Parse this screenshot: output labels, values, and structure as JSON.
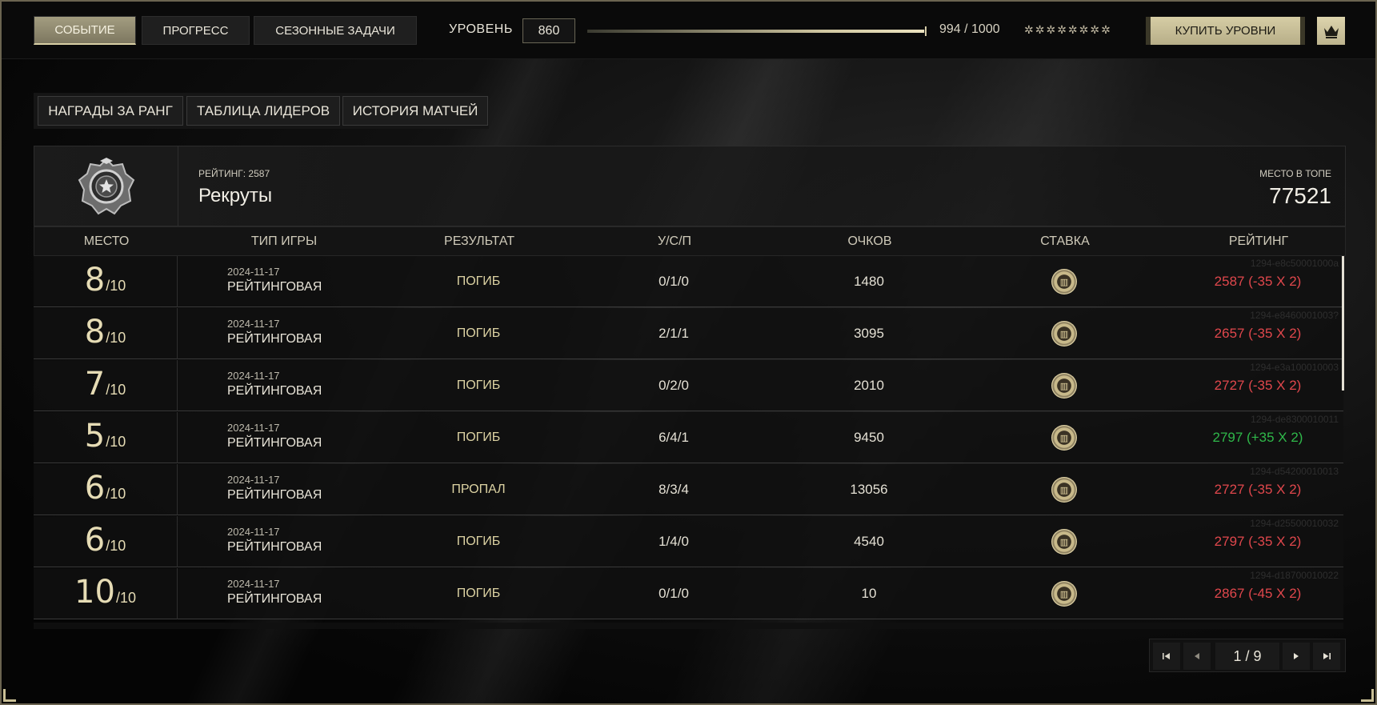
{
  "top_tabs": [
    {
      "label": "СОБЫТИЕ",
      "active": true
    },
    {
      "label": "ПРОГРЕСС",
      "active": false
    },
    {
      "label": "СЕЗОННЫЕ ЗАДАЧИ",
      "active": false
    }
  ],
  "level": {
    "label": "УРОВЕНЬ",
    "value": "860",
    "xp_text": "994 / 1000",
    "xp_fraction": 0.994,
    "stars": "✲✲✲✲✲✲✲✲"
  },
  "buy_levels_label": "КУПИТЬ УРОВНИ",
  "crown_icon": "crown-icon",
  "sub_tabs": [
    "НАГРАДЫ ЗА РАНГ",
    "ТАБЛИЦА ЛИДЕРОВ",
    "ИСТОРИЯ МАТЧЕЙ"
  ],
  "rank": {
    "rating_label": "РЕЙТИНГ: 2587",
    "name": "Рекруты",
    "top_label": "МЕСТО В ТОПЕ",
    "top_value": "77521"
  },
  "table": {
    "headers": [
      "МЕСТО",
      "ТИП ИГРЫ",
      "РЕЗУЛЬТАТ",
      "У/С/П",
      "ОЧКОВ",
      "СТАВКА",
      "РЕЙТИНГ"
    ],
    "rows": [
      {
        "place": "8",
        "of": "/10",
        "date": "2024-11-17",
        "type": "РЕЙТИНГОВАЯ",
        "result": "ПОГИБ",
        "ksa": "0/1/0",
        "points": "1480",
        "rating": "2587 (-35 X 2)",
        "positive": false,
        "id": "1294-e8c50001000a"
      },
      {
        "place": "8",
        "of": "/10",
        "date": "2024-11-17",
        "type": "РЕЙТИНГОВАЯ",
        "result": "ПОГИБ",
        "ksa": "2/1/1",
        "points": "3095",
        "rating": "2657 (-35 X 2)",
        "positive": false,
        "id": "1294-e8460001003?"
      },
      {
        "place": "7",
        "of": "/10",
        "date": "2024-11-17",
        "type": "РЕЙТИНГОВАЯ",
        "result": "ПОГИБ",
        "ksa": "0/2/0",
        "points": "2010",
        "rating": "2727 (-35 X 2)",
        "positive": false,
        "id": "1294-e3a100010003"
      },
      {
        "place": "5",
        "of": "/10",
        "date": "2024-11-17",
        "type": "РЕЙТИНГОВАЯ",
        "result": "ПОГИБ",
        "ksa": "6/4/1",
        "points": "9450",
        "rating": "2797 (+35 X 2)",
        "positive": true,
        "id": "1294-de8300010011"
      },
      {
        "place": "6",
        "of": "/10",
        "date": "2024-11-17",
        "type": "РЕЙТИНГОВАЯ",
        "result": "ПРОПАЛ",
        "ksa": "8/3/4",
        "points": "13056",
        "rating": "2727 (-35 X 2)",
        "positive": false,
        "id": "1294-d54200010013"
      },
      {
        "place": "6",
        "of": "/10",
        "date": "2024-11-17",
        "type": "РЕЙТИНГОВАЯ",
        "result": "ПОГИБ",
        "ksa": "1/4/0",
        "points": "4540",
        "rating": "2797 (-35 X 2)",
        "positive": false,
        "id": "1294-d25500010032"
      },
      {
        "place": "10",
        "of": "/10",
        "date": "2024-11-17",
        "type": "РЕЙТИНГОВАЯ",
        "result": "ПОГИБ",
        "ksa": "0/1/0",
        "points": "10",
        "rating": "2867 (-45 X 2)",
        "positive": false,
        "id": "1294-d18700010022"
      }
    ],
    "stake_icon": "poker-chip-icon"
  },
  "pagination": {
    "text": "1 / 9"
  },
  "colors": {
    "accent": "#cfc6a0",
    "negative": "#e0474c",
    "positive": "#2fb84a"
  }
}
